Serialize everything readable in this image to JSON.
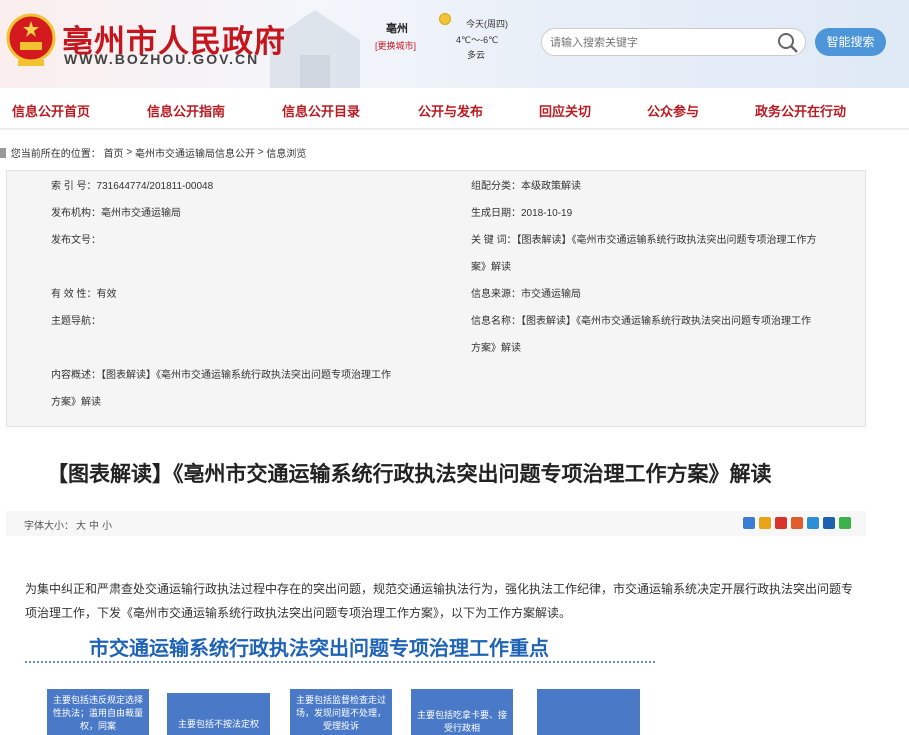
{
  "header": {
    "title": "亳州市人民政府",
    "domain": "WWW.BOZHOU.GOV.CN",
    "city": "亳州",
    "switch_city": "[更换城市]",
    "weather_day": "今天(周四)",
    "weather_temp": "4℃～-6℃",
    "weather_cond": "多云",
    "search_placeholder": "请输入搜索关键字",
    "smart_search": "智能搜索"
  },
  "nav": [
    "信息公开首页",
    "信息公开指南",
    "信息公开目录",
    "公开与发布",
    "回应关切",
    "公众参与",
    "政务公开在行动"
  ],
  "breadcrumb": {
    "prefix": "您当前所在的位置：",
    "home": "首页",
    "sep1": " > ",
    "section": "亳州市交通运输局信息公开",
    "sep2": " > ",
    "current": "信息浏览"
  },
  "meta": {
    "index_no": "索 引 号：731644774/201811-00048",
    "category": "组配分类：本级政策解读",
    "publisher": "发布机构：亳州市交通运输局",
    "date": "生成日期：2018-10-19",
    "doc_no": "发布文号：",
    "keywords_l1": "关 键 词：【图表解读】《亳州市交通运输系统行政执法突出问题专项治理工作方",
    "keywords_l2": "案》解读",
    "validity": "有 效 性：有效",
    "source": "信息来源：市交通运输局",
    "topic": "主题导航：",
    "info_name_l1": "信息名称：【图表解读】《亳州市交通运输系统行政执法突出问题专项治理工作",
    "info_name_l2": "方案》解读",
    "summary_l1": "内容概述：【图表解读】《亳州市交通运输系统行政执法突出问题专项治理工作",
    "summary_l2": "方案》解读"
  },
  "article": {
    "title": "【图表解读】《亳州市交通运输系统行政执法突出问题专项治理工作方案》解读",
    "font_size_label": "字体大小：",
    "fs_large": "大",
    "fs_medium": "中",
    "fs_small": "小",
    "paragraph": "为集中纠正和严肃查处交通运输行政执法过程中存在的突出问题，规范交通运输执法行为，强化执法工作纪律，市交通运输系统决定开展行政执法突出问题专项治理工作，下发《亳州市交通运输系统行政执法突出问题专项治理工作方案》，以下为工作方案解读。",
    "banner": "市交通运输系统行政执法突出问题专项治理工作重点",
    "cards": [
      "主要包括违反规定选择性执法；滥用自由裁量权，同案",
      "主要包括不按法定权",
      "主要包括监督检查走过场，发现问题不处理，受理投诉",
      "主要包括吃拿卡要、接受行政相",
      ""
    ]
  },
  "colors": {
    "brand_red": "#c5161d",
    "nav_red": "#b81c22",
    "accent_blue": "#4c95d8",
    "card_blue": "#4a7ac7",
    "banner_blue": "#1f63b6"
  }
}
